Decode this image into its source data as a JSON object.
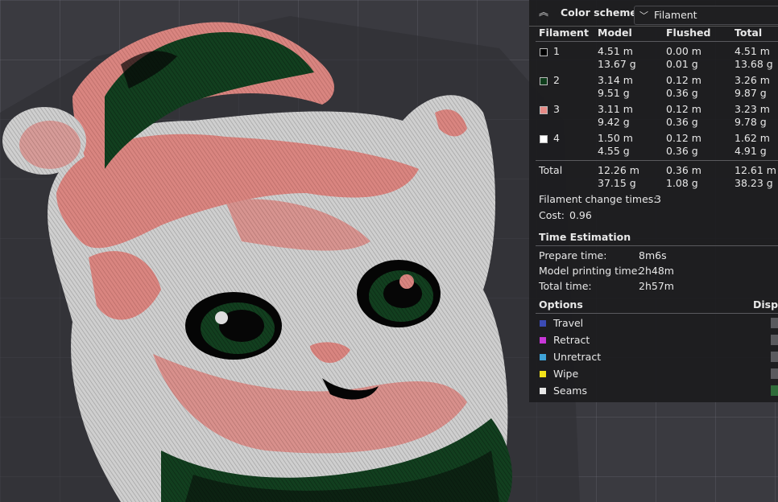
{
  "header": {
    "title": "Color scheme",
    "scheme_value": "Filament"
  },
  "columns": {
    "filament": "Filament",
    "model": "Model",
    "flushed": "Flushed",
    "total": "Total"
  },
  "filaments": [
    {
      "id": "1",
      "color": "#000000",
      "model_m": "4.51 m",
      "model_g": "13.67 g",
      "flushed_m": "0.00 m",
      "flushed_g": "0.01 g",
      "total_m": "4.51 m",
      "total_g": "13.68 g"
    },
    {
      "id": "2",
      "color": "#0f3d1c",
      "model_m": "3.14 m",
      "model_g": "9.51 g",
      "flushed_m": "0.12 m",
      "flushed_g": "0.36 g",
      "total_m": "3.26 m",
      "total_g": "9.87 g"
    },
    {
      "id": "3",
      "color": "#e58a86",
      "model_m": "3.11 m",
      "model_g": "9.42 g",
      "flushed_m": "0.12 m",
      "flushed_g": "0.36 g",
      "total_m": "3.23 m",
      "total_g": "9.78 g"
    },
    {
      "id": "4",
      "color": "#ffffff",
      "model_m": "1.50 m",
      "model_g": "4.55 g",
      "flushed_m": "0.12 m",
      "flushed_g": "0.36 g",
      "total_m": "1.62 m",
      "total_g": "4.91 g"
    }
  ],
  "total": {
    "label": "Total",
    "model_m": "12.26 m",
    "model_g": "37.15 g",
    "flushed_m": "0.36 m",
    "flushed_g": "1.08 g",
    "total_m": "12.61 m",
    "total_g": "38.23 g"
  },
  "filament_change": {
    "label": "Filament change times:",
    "value": "3"
  },
  "cost": {
    "label": "Cost:",
    "value": "0.96"
  },
  "time": {
    "section": "Time Estimation",
    "prepare_label": "Prepare time:",
    "prepare_value": "8m6s",
    "model_label": "Model printing time:",
    "model_value": "2h48m",
    "total_label": "Total time:",
    "total_value": "2h57m"
  },
  "options": {
    "section": "Options",
    "display_header": "Displ",
    "items": [
      {
        "label": "Travel",
        "color": "#3b4bb5",
        "checked": false
      },
      {
        "label": "Retract",
        "color": "#c837d8",
        "checked": false
      },
      {
        "label": "Unretract",
        "color": "#3fa3d8",
        "checked": false
      },
      {
        "label": "Wipe",
        "color": "#f2e21a",
        "checked": false
      },
      {
        "label": "Seams",
        "color": "#e6e6e6",
        "checked": true
      }
    ]
  }
}
